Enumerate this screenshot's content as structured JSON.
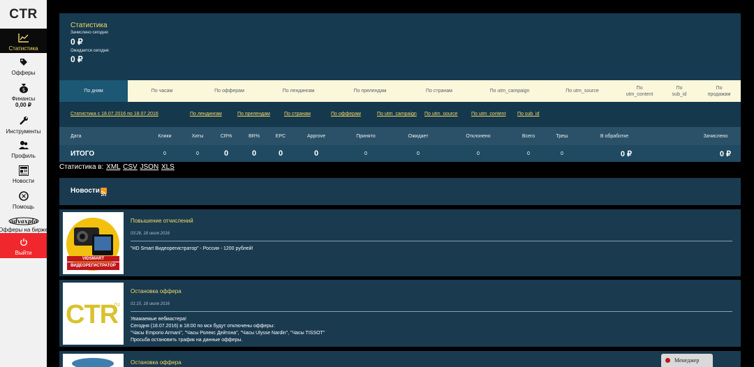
{
  "sidebar": {
    "logo": "CTR",
    "items": [
      {
        "label": "Статистика",
        "icon": "chart-icon"
      },
      {
        "label": "Офферы",
        "icon": "tag-icon"
      },
      {
        "label": "Финансы",
        "icon": "money-bag-icon",
        "balance": "0,00 ₽"
      },
      {
        "label": "Инструменты",
        "icon": "wrench-icon"
      },
      {
        "label": "Профиль",
        "icon": "user-icon"
      },
      {
        "label": "Новости",
        "icon": "news-icon"
      },
      {
        "label": "Помощь",
        "icon": "help-icon"
      },
      {
        "label": "Офферы на бирже",
        "icon": "exchange-logo-icon"
      },
      {
        "label": "Выйти",
        "icon": "power-icon"
      }
    ]
  },
  "stats": {
    "title": "Статистика",
    "credited_label": "Зачислено сегодня:",
    "credited_value": "0 ₽",
    "expected_label": "Ожидается сегодня:",
    "expected_value": "0 ₽"
  },
  "tabs": [
    "По дням",
    "По часам",
    "По офферам",
    "По лендингам",
    "По прелендам",
    "По странам",
    "По utm_campaign",
    "По utm_source",
    "По utm_content",
    "По sub_id",
    "По продажам"
  ],
  "filters": {
    "period": "Статистика с 18.07.2016 по 18.07.2016",
    "links": [
      "По лендингам",
      "По прелендам",
      "По странам",
      "По офферам",
      "По utm_campaign",
      "По utm_source",
      "По utm_content",
      "По sub_id"
    ]
  },
  "table": {
    "headers": [
      "Дата",
      "Клики",
      "Хиты",
      "CR%",
      "BR%",
      "EPC",
      "Approve",
      "Принято",
      "Ожидает",
      "Отклонено",
      "Всего",
      "Треш",
      "В обработке",
      "Зачислено"
    ],
    "total": [
      "ИТОГО",
      "0",
      "0",
      "0",
      "0",
      "0",
      "0",
      "0",
      "0",
      "0",
      "0",
      "0",
      "0 ₽",
      "0 ₽"
    ]
  },
  "export": {
    "label": "Статистика в:",
    "formats": [
      "XML",
      "CSV",
      "JSON",
      "XLS"
    ]
  },
  "news": {
    "title": "Новости",
    "items": [
      {
        "title": "Повышение отчислений",
        "date": "03:26, 18 июля 2016",
        "body": [
          "\"HD Smart Видеорегистратор\" - Россия - 1200 рублей!"
        ],
        "image_caption": "ВИДЕОРЕГИСТРАТОР",
        "image_brand": "VIDSMART"
      },
      {
        "title": "Остановка оффера",
        "date": "01:15, 18 июля 2016",
        "body": [
          "Уважаемые вебмастера!",
          "Сегодня (18.07.2016) в 18:00 по мск будут отключены офферы:",
          "\"Часы Emporio Armani\", \"Часы Ролекс Дейтона\", \"Часы Ulysse Nardin\", \"Часы TISSOT\"",
          "Просьба остановить трафик на данные офферы."
        ],
        "image_logo": "CTR",
        "image_logo_suffix": ".ru"
      },
      {
        "title": "Остановка оффера"
      }
    ]
  },
  "manager": {
    "label": "Менеджер"
  },
  "colors": {
    "accent": "#f1d96a",
    "panel": "#1b3b52",
    "tabs_bg": "#fbf7da",
    "logout": "#f0272c"
  }
}
